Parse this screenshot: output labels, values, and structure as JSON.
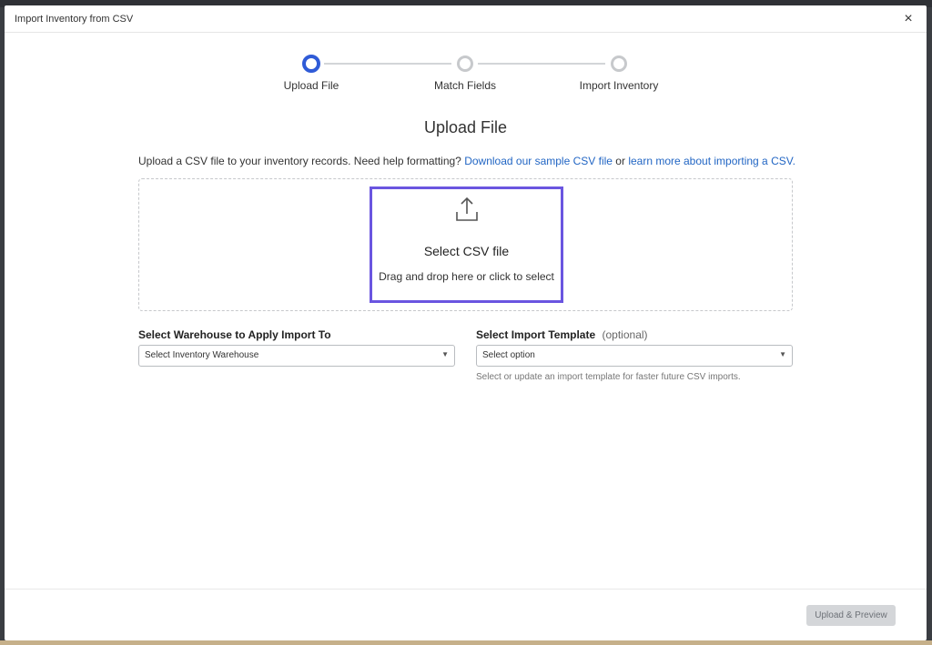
{
  "modal": {
    "title": "Import Inventory from CSV",
    "close_label": "×"
  },
  "stepper": {
    "steps": [
      {
        "label": "Upload File",
        "state": "active"
      },
      {
        "label": "Match Fields",
        "state": "inactive"
      },
      {
        "label": "Import Inventory",
        "state": "inactive"
      }
    ]
  },
  "upload": {
    "title": "Upload File",
    "intro_text": "Upload a CSV file to your inventory records. Need help formatting?",
    "sample_link": "Download our sample CSV file",
    "or_text": "or",
    "learn_link": "learn more about importing a CSV.",
    "drop_title": "Select CSV file",
    "drop_subtitle": "Drag and drop here or click to select",
    "icon": "upload-icon"
  },
  "warehouse": {
    "label": "Select Warehouse to Apply Import To",
    "value": "Select Inventory Warehouse"
  },
  "template": {
    "label": "Select Import Template",
    "optional": "(optional)",
    "value": "Select option",
    "help": "Select or update an import template for faster future CSV imports."
  },
  "footer": {
    "upload_button": "Upload & Preview"
  },
  "colors": {
    "accent": "#2f5bd7",
    "link": "#2266c4",
    "drop_highlight": "#6a55e0",
    "disabled_button": "#d4d6d9"
  }
}
